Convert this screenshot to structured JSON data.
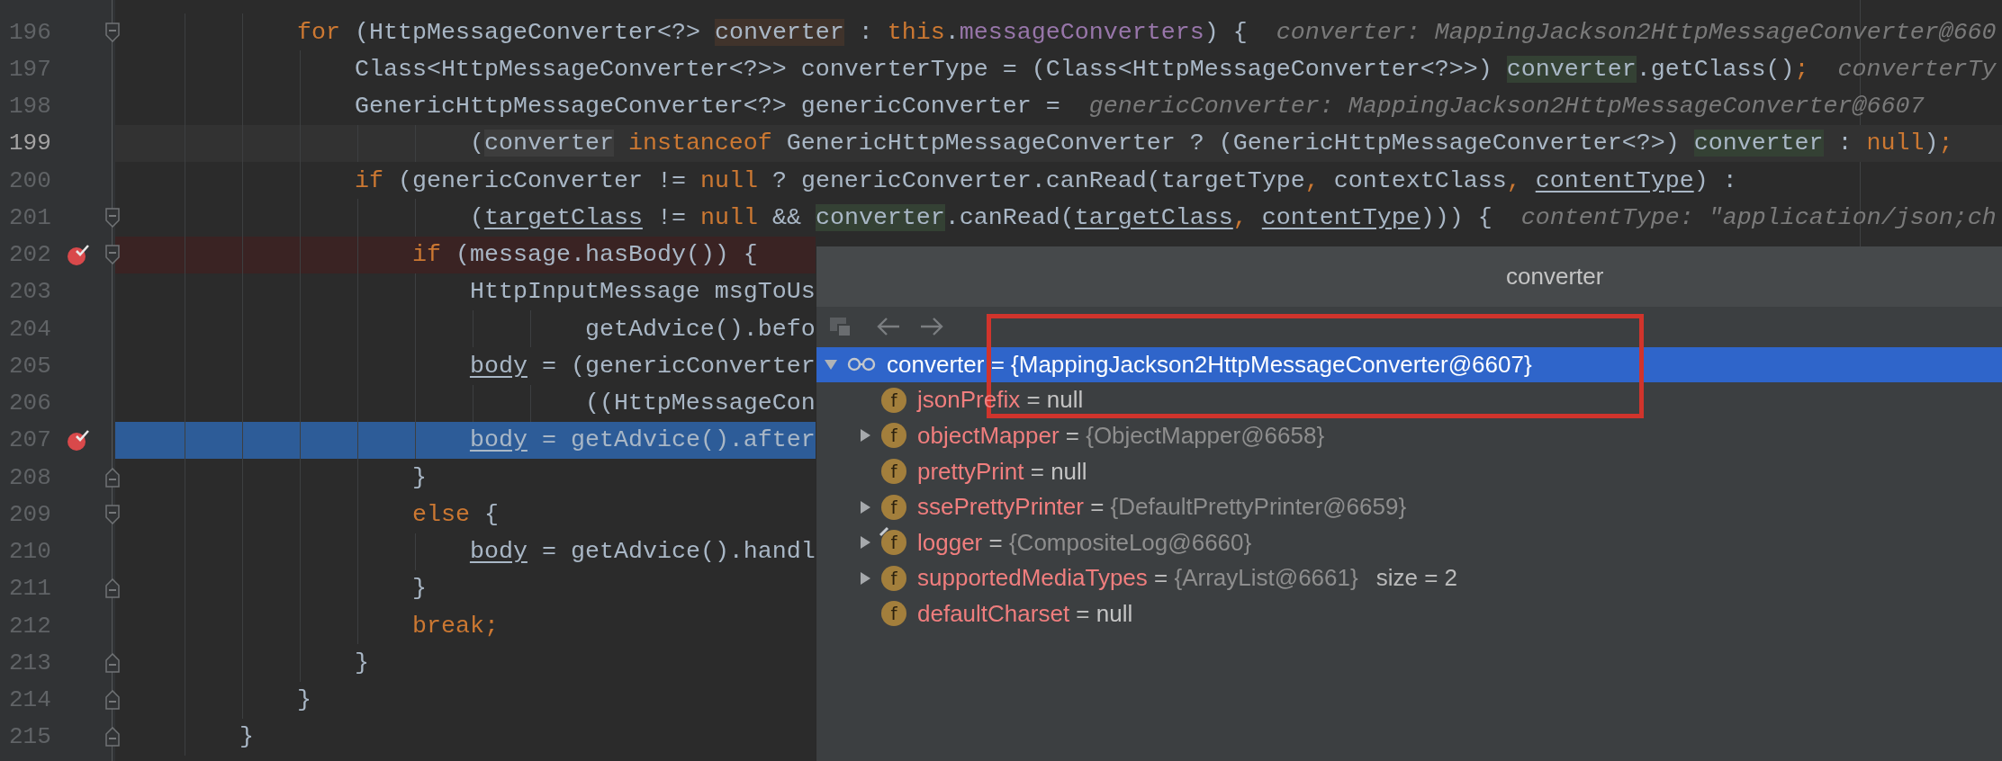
{
  "editor": {
    "lines": [
      {
        "number": "196",
        "breakpoint": false,
        "current": false,
        "stopped": false,
        "fold_start": true,
        "fold_end": false,
        "tokens": [
          {
            "kind": "keyword",
            "text": "            for"
          },
          {
            "kind": "plain",
            "text": " (HttpMessageConverter<?> "
          },
          {
            "kind": "declaration",
            "text": "converter"
          },
          {
            "kind": "plain",
            "text": " : "
          },
          {
            "kind": "keyword",
            "text": "this"
          },
          {
            "kind": "plain",
            "text": "."
          },
          {
            "kind": "field",
            "text": "messageConverters"
          },
          {
            "kind": "plain",
            "text": ") {  "
          },
          {
            "kind": "hint",
            "text": "converter: MappingJackson2HttpMessageConverter@660"
          }
        ]
      },
      {
        "number": "197",
        "breakpoint": false,
        "current": false,
        "stopped": false,
        "fold_start": false,
        "fold_end": false,
        "tokens": [
          {
            "kind": "plain",
            "text": "                Class<HttpMessageConverter<?>> converterType = (Class<HttpMessageConverter<?>>) "
          },
          {
            "kind": "usage",
            "text": "converter"
          },
          {
            "kind": "plain",
            "text": ".getClass()"
          },
          {
            "kind": "keyword",
            "text": ";  "
          },
          {
            "kind": "hint",
            "text": "converterTy"
          }
        ]
      },
      {
        "number": "198",
        "breakpoint": false,
        "current": false,
        "stopped": false,
        "fold_start": false,
        "fold_end": false,
        "tokens": [
          {
            "kind": "plain",
            "text": "                GenericHttpMessageConverter<?> genericConverter =  "
          },
          {
            "kind": "hint",
            "text": "genericConverter: MappingJackson2HttpMessageConverter@6607"
          }
        ]
      },
      {
        "number": "199",
        "breakpoint": false,
        "current": true,
        "stopped": false,
        "fold_start": false,
        "fold_end": false,
        "tokens": [
          {
            "kind": "plain",
            "text": "                        ("
          },
          {
            "kind": "caret-usage",
            "text": "converter"
          },
          {
            "kind": "keyword",
            "text": " instanceof"
          },
          {
            "kind": "plain",
            "text": " GenericHttpMessageConverter ? (GenericHttpMessageConverter<?>) "
          },
          {
            "kind": "usage",
            "text": "converter"
          },
          {
            "kind": "plain",
            "text": " : "
          },
          {
            "kind": "keyword",
            "text": "null"
          },
          {
            "kind": "plain",
            "text": ")"
          },
          {
            "kind": "keyword",
            "text": ";"
          }
        ]
      },
      {
        "number": "200",
        "breakpoint": false,
        "current": false,
        "stopped": false,
        "fold_start": false,
        "fold_end": false,
        "tokens": [
          {
            "kind": "keyword",
            "text": "                if"
          },
          {
            "kind": "plain",
            "text": " (genericConverter != "
          },
          {
            "kind": "keyword",
            "text": "null"
          },
          {
            "kind": "plain",
            "text": " ? genericConverter.canRead(targetType"
          },
          {
            "kind": "keyword",
            "text": ","
          },
          {
            "kind": "plain",
            "text": " contextClass"
          },
          {
            "kind": "keyword",
            "text": ", "
          },
          {
            "kind": "var",
            "text": "contentType"
          },
          {
            "kind": "plain",
            "text": ") :"
          }
        ]
      },
      {
        "number": "201",
        "breakpoint": false,
        "current": false,
        "stopped": false,
        "fold_start": true,
        "fold_end": false,
        "tokens": [
          {
            "kind": "plain",
            "text": "                        ("
          },
          {
            "kind": "var",
            "text": "targetClass"
          },
          {
            "kind": "plain",
            "text": " != "
          },
          {
            "kind": "keyword",
            "text": "null"
          },
          {
            "kind": "plain",
            "text": " && "
          },
          {
            "kind": "usage",
            "text": "converter"
          },
          {
            "kind": "plain",
            "text": ".canRead("
          },
          {
            "kind": "var",
            "text": "targetClass"
          },
          {
            "kind": "keyword",
            "text": ", "
          },
          {
            "kind": "var",
            "text": "contentType"
          },
          {
            "kind": "plain",
            "text": "))) {  "
          },
          {
            "kind": "hint",
            "text": "contentType: \"application/json;ch"
          }
        ]
      },
      {
        "number": "202",
        "breakpoint": true,
        "current": false,
        "stopped": false,
        "fold_start": true,
        "fold_end": false,
        "tokens": [
          {
            "kind": "keyword",
            "text": "                    if"
          },
          {
            "kind": "plain",
            "text": " (message.hasBody()) {"
          }
        ]
      },
      {
        "number": "203",
        "breakpoint": false,
        "current": false,
        "stopped": false,
        "fold_start": false,
        "fold_end": false,
        "tokens": [
          {
            "kind": "plain",
            "text": "                        HttpInputMessage msgToUs"
          }
        ]
      },
      {
        "number": "204",
        "breakpoint": false,
        "current": false,
        "stopped": false,
        "fold_start": false,
        "fold_end": false,
        "tokens": [
          {
            "kind": "plain",
            "text": "                                getAdvice().befo"
          }
        ]
      },
      {
        "number": "205",
        "breakpoint": false,
        "current": false,
        "stopped": false,
        "fold_start": false,
        "fold_end": false,
        "tokens": [
          {
            "kind": "var",
            "text": "                        body"
          },
          {
            "kind": "plain",
            "text": " = (genericConverter"
          }
        ]
      },
      {
        "number": "206",
        "breakpoint": false,
        "current": false,
        "stopped": false,
        "fold_start": false,
        "fold_end": false,
        "tokens": [
          {
            "kind": "plain",
            "text": "                                ((HttpMessageCon"
          }
        ]
      },
      {
        "number": "207",
        "breakpoint": true,
        "current": false,
        "stopped": true,
        "fold_start": false,
        "fold_end": false,
        "tokens": [
          {
            "kind": "var",
            "text": "                        body"
          },
          {
            "kind": "plain",
            "text": " = getAdvice().after"
          }
        ]
      },
      {
        "number": "208",
        "breakpoint": false,
        "current": false,
        "stopped": false,
        "fold_start": false,
        "fold_end": true,
        "tokens": [
          {
            "kind": "plain",
            "text": "                    }"
          }
        ]
      },
      {
        "number": "209",
        "breakpoint": false,
        "current": false,
        "stopped": false,
        "fold_start": true,
        "fold_end": false,
        "tokens": [
          {
            "kind": "keyword",
            "text": "                    else"
          },
          {
            "kind": "plain",
            "text": " {"
          }
        ]
      },
      {
        "number": "210",
        "breakpoint": false,
        "current": false,
        "stopped": false,
        "fold_start": false,
        "fold_end": false,
        "tokens": [
          {
            "kind": "var",
            "text": "                        body"
          },
          {
            "kind": "plain",
            "text": " = getAdvice().handl"
          }
        ]
      },
      {
        "number": "211",
        "breakpoint": false,
        "current": false,
        "stopped": false,
        "fold_start": false,
        "fold_end": true,
        "tokens": [
          {
            "kind": "plain",
            "text": "                    }"
          }
        ]
      },
      {
        "number": "212",
        "breakpoint": false,
        "current": false,
        "stopped": false,
        "fold_start": false,
        "fold_end": false,
        "tokens": [
          {
            "kind": "keyword",
            "text": "                    break;"
          }
        ]
      },
      {
        "number": "213",
        "breakpoint": false,
        "current": false,
        "stopped": false,
        "fold_start": false,
        "fold_end": true,
        "tokens": [
          {
            "kind": "plain",
            "text": "                }"
          }
        ]
      },
      {
        "number": "214",
        "breakpoint": false,
        "current": false,
        "stopped": false,
        "fold_start": false,
        "fold_end": true,
        "tokens": [
          {
            "kind": "plain",
            "text": "            }"
          }
        ]
      },
      {
        "number": "215",
        "breakpoint": false,
        "current": false,
        "stopped": false,
        "fold_start": false,
        "fold_end": true,
        "tokens": [
          {
            "kind": "plain",
            "text": "        }"
          }
        ]
      }
    ]
  },
  "debugger_popup": {
    "title": "converter",
    "toolbar": [
      {
        "kind": "frames"
      },
      {
        "kind": "back"
      },
      {
        "kind": "forward"
      }
    ],
    "tree": {
      "kind": "watch",
      "name": "converter",
      "separator": "=",
      "value": "{MappingJackson2HttpMessageConverter@6607}",
      "selected": true,
      "expanded": true,
      "children": [
        {
          "kind": "field",
          "badge": "f",
          "name": "jsonPrefix",
          "separator": "=",
          "value": "null",
          "literal": true,
          "selected": false
        },
        {
          "kind": "field",
          "badge": "f",
          "name": "objectMapper",
          "separator": "=",
          "value": "{ObjectMapper@6658}",
          "literal": false,
          "selected": false,
          "expanded": false
        },
        {
          "kind": "field",
          "badge": "f",
          "name": "prettyPrint",
          "separator": "=",
          "value": "null",
          "literal": true,
          "selected": false
        },
        {
          "kind": "field",
          "badge": "f",
          "name": "ssePrettyPrinter",
          "separator": "=",
          "value": "{DefaultPrettyPrinter@6659}",
          "literal": false,
          "selected": false,
          "expanded": false
        },
        {
          "kind": "static-field",
          "badge": "f",
          "name": "logger",
          "separator": "=",
          "value": "{CompositeLog@6660}",
          "literal": false,
          "selected": false,
          "expanded": false
        },
        {
          "kind": "field",
          "badge": "f",
          "name": "supportedMediaTypes",
          "separator": "=",
          "value": "{ArrayList@6661}",
          "literal": false,
          "extra": "size = 2",
          "selected": false,
          "expanded": false
        },
        {
          "kind": "field",
          "badge": "f",
          "name": "defaultCharset",
          "separator": "=",
          "value": "null",
          "literal": true,
          "selected": false
        }
      ]
    }
  },
  "annotation": {
    "kind": "rectangle"
  }
}
